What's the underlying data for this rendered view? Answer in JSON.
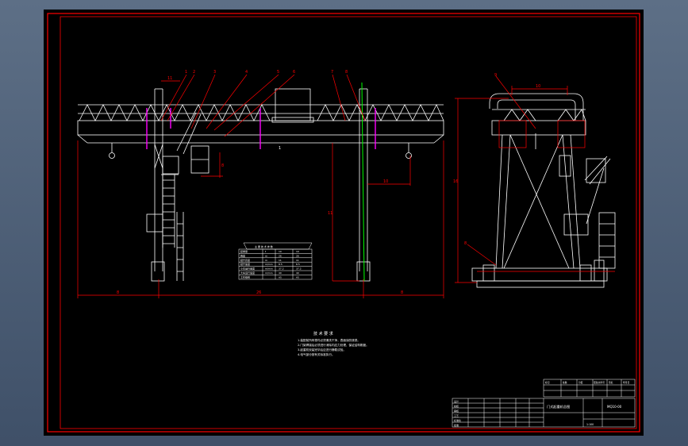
{
  "viewport": {
    "background": "#000000",
    "frame_color": "#ff0000",
    "line_color": "#ffffff",
    "dim_color": "#ff0000",
    "accent_color": "#ff00ff",
    "rail_color": "#00ff00"
  },
  "front_view": {
    "part_numbers": [
      "11",
      "1",
      "2",
      "3",
      "4",
      "5",
      "6",
      "7",
      "8"
    ],
    "dimensions": {
      "left_overhang": "8",
      "span": "26",
      "right_overhang": "8",
      "height": "11",
      "hook_offset": "10",
      "cab_width": "8"
    },
    "section_marker": "1"
  },
  "side_view": {
    "part_numbers": [
      "9",
      "8"
    ],
    "dimensions": {
      "top_width": "10",
      "height": "16"
    }
  },
  "spec_table": {
    "title": "主 要 技 术 参 数",
    "rows": [
      [
        "起重量",
        "t",
        "10",
        "10"
      ],
      [
        "跨度",
        "m",
        "26",
        "26"
      ],
      [
        "起升高度",
        "m",
        "11",
        "11"
      ],
      [
        "起升速度",
        "m/min",
        "8.5",
        "8.5"
      ],
      [
        "小车运行速度",
        "m/min",
        "37.2",
        "37.2"
      ],
      [
        "大车运行速度",
        "m/min",
        "40",
        "40"
      ],
      [
        "工作级别",
        "",
        "A5",
        "A5"
      ]
    ]
  },
  "notes": {
    "title": "技 术 要 求",
    "lines": [
      "1.装配前所有零件必须清洗干净，表面涂防锈漆。",
      "2.门架焊接后必须进行消除内应力处理，保证结构刚度。",
      "3.起重机安装完毕后应进行静载试验。",
      "4.电气部分按有关标准执行。"
    ]
  },
  "title_block": {
    "drawing_name": "门式起重机总图",
    "sheet_code": "MQ10-00",
    "scale": "1:100",
    "roles": [
      "设计",
      "校核",
      "审核",
      "工艺",
      "标准化",
      "批准"
    ],
    "revision_headers": [
      "标记",
      "处数",
      "分区",
      "更改文件号",
      "签名",
      "年月日"
    ]
  }
}
